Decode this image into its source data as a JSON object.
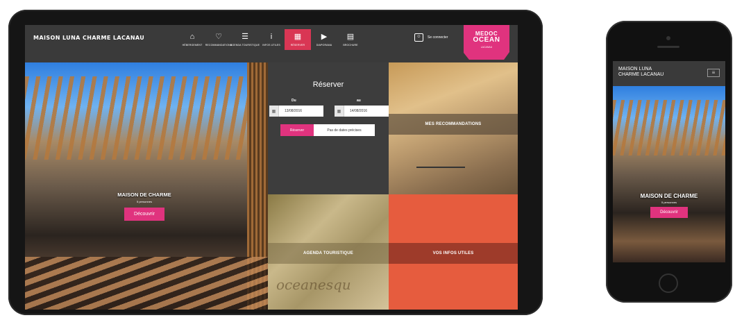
{
  "tablet": {
    "site_title": "MAISON LUNA CHARME LACANAU",
    "nav": [
      {
        "icon": "home-icon",
        "glyph": "⌂",
        "label": "HÉBERGEMENT",
        "active": false
      },
      {
        "icon": "heart-icon",
        "glyph": "♡",
        "label": "RECOMMANDATIONS",
        "active": false
      },
      {
        "icon": "rss-icon",
        "glyph": "☰",
        "label": "AGENDA TOURISTIQUE",
        "active": false
      },
      {
        "icon": "info-icon",
        "glyph": "i",
        "label": "INFOS UTILES",
        "active": false
      },
      {
        "icon": "calendar-icon",
        "glyph": "▦",
        "label": "RÉSERVER",
        "active": true
      },
      {
        "icon": "play-icon",
        "glyph": "▶",
        "label": "DIAPORAMA",
        "active": false
      },
      {
        "icon": "document-icon",
        "glyph": "▤",
        "label": "BROCHURE",
        "active": false
      }
    ],
    "login_label": "Se connecter",
    "logo": {
      "line1": "MEDOC",
      "line2": "OCEAN",
      "line3": "LACANAU"
    },
    "hero": {
      "title": "MAISON DE CHARME",
      "subtitle": "5 personnes",
      "button": "Découvrir"
    },
    "reserve": {
      "title": "Réserver",
      "from_label": "Du",
      "to_label": "au",
      "from_value": "13/08/2016",
      "to_value": "14/08/2016",
      "submit": "Réserver",
      "no_dates": "Pas de dates précises"
    },
    "tiles": {
      "reco": "MES RECOMMANDATIONS",
      "agenda": "AGENDA TOURISTIQUE",
      "infos": "VOS INFOS UTILES"
    },
    "sand_writing": "oceanesqu"
  },
  "phone": {
    "title_line1": "MAISON LUNA",
    "title_line2": "CHARME LACANAU",
    "hero_title": "MAISON DE CHARME",
    "hero_subtitle": "5 personnes",
    "button": "Découvrir"
  },
  "colors": {
    "accent": "#e0337e",
    "active_nav": "#d93654",
    "orange_tile": "#e65c3e",
    "topbar": "#3a3a3a"
  }
}
